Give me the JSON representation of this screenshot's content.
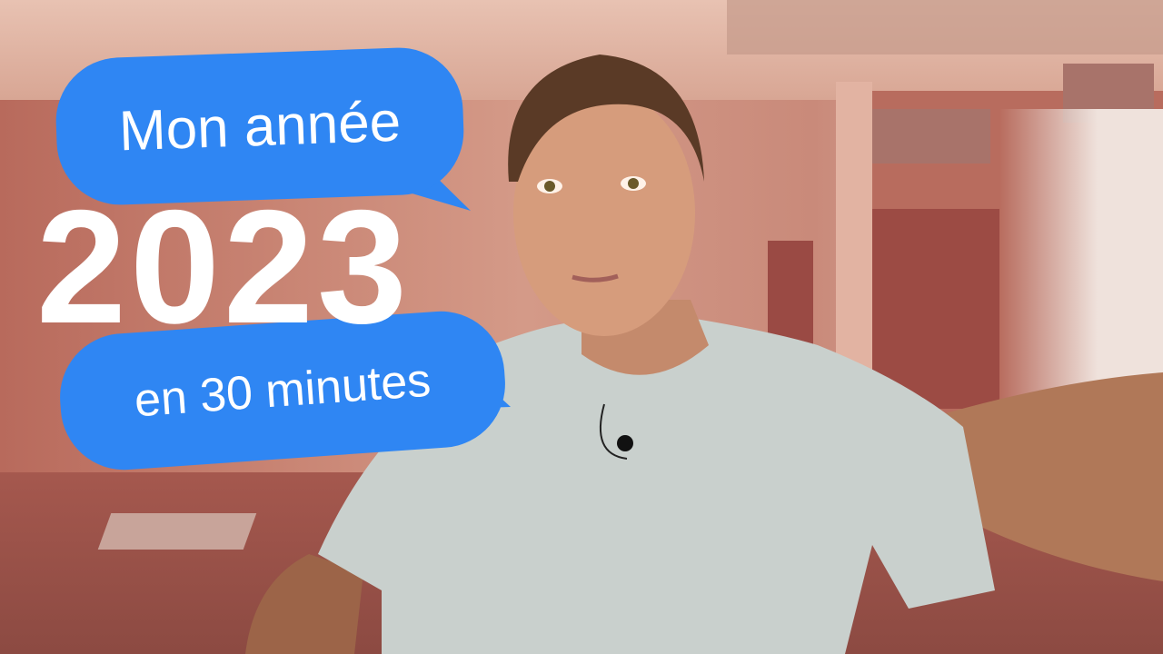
{
  "overlay": {
    "bubble_top": "Mon année",
    "year": "2023",
    "bubble_bottom": "en 30 minutes"
  },
  "colors": {
    "bubble": "#2f86f3",
    "text": "#ffffff"
  }
}
